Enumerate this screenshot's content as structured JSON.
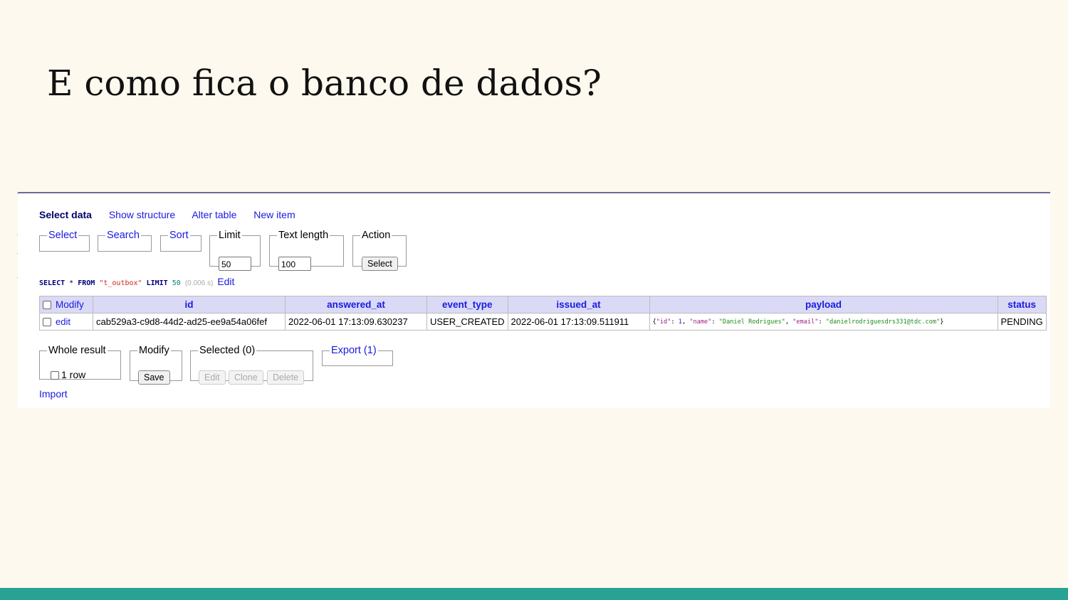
{
  "slide": {
    "title": "E como fica o banco de dados?"
  },
  "nav": {
    "items": [
      "Select data",
      "Show structure",
      "Alter table",
      "New item"
    ]
  },
  "controls": {
    "select": "Select",
    "search": "Search",
    "sort": "Sort",
    "limit": {
      "label": "Limit",
      "value": "50"
    },
    "text_length": {
      "label": "Text length",
      "value": "100"
    },
    "action": {
      "label": "Action",
      "button": "Select"
    }
  },
  "query": {
    "kw_select": "SELECT",
    "star": "*",
    "kw_from": "FROM",
    "table": "\"t_outbox\"",
    "kw_limit": "LIMIT",
    "limit": "50",
    "time": "(0.006 s)",
    "edit": "Edit"
  },
  "table": {
    "modify_header": "Modify",
    "columns": [
      "id",
      "answered_at",
      "event_type",
      "issued_at",
      "payload",
      "status"
    ],
    "rows": [
      {
        "edit": "edit",
        "id": "cab529a3-c9d8-44d2-ad25-ee9a54a06fef",
        "answered_at": "2022-06-01 17:13:09.630237",
        "event_type": "USER_CREATED",
        "issued_at": "2022-06-01 17:13:09.511911",
        "payload": {
          "open": "{",
          "k_id": "\"id\"",
          "v_id": "1",
          "k_name": "\"name\"",
          "v_name": "\"Daniel Rodrigues\"",
          "k_email": "\"email\"",
          "v_email": "\"danielrodriguesdrs331@tdc.com\"",
          "close": "}"
        },
        "status": "PENDING"
      }
    ]
  },
  "bottom": {
    "whole_result": {
      "label": "Whole result",
      "checkbox": "1 row"
    },
    "modify": {
      "label": "Modify",
      "button": "Save"
    },
    "selected": {
      "label": "Selected (0)",
      "buttons": [
        "Edit",
        "Clone",
        "Delete"
      ]
    },
    "export": "Export (1)",
    "import": "Import"
  },
  "colors": {
    "background": "#fdf9ee",
    "accent_bar": "#27a293",
    "link": "#1a1ae0",
    "header_bg": "#dadaf7"
  }
}
